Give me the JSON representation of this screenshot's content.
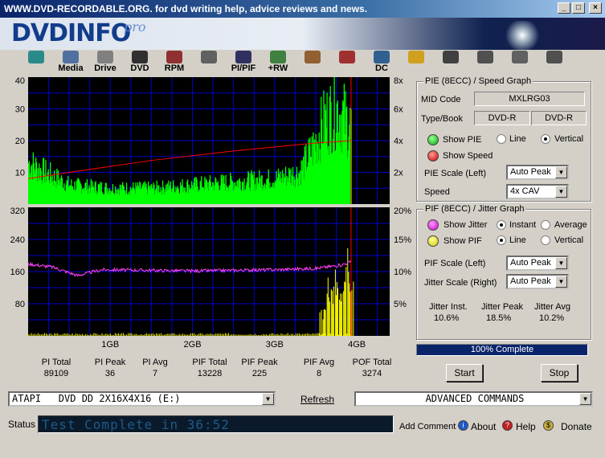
{
  "window": {
    "title": "WWW.DVD-RECORDABLE.ORG.  for dvd writing help, advice reviews and news.",
    "minimize": "_",
    "maximize": "□",
    "close": "×"
  },
  "banner": {
    "logo": "DVDINFO",
    "logo_pro": "pro"
  },
  "toolbar": [
    {
      "label": "",
      "icon": "monitor-icon"
    },
    {
      "label": "Media",
      "icon": "media-icon"
    },
    {
      "label": "Drive",
      "icon": "drive-icon"
    },
    {
      "label": "DVD",
      "icon": "dvd-icon"
    },
    {
      "label": "RPM",
      "icon": "rpm-icon"
    },
    {
      "label": "",
      "icon": "magnifier-icon"
    },
    {
      "label": "PI/PIF",
      "icon": "pipif-icon"
    },
    {
      "label": "+RW",
      "icon": "rw-icon"
    },
    {
      "label": "",
      "icon": "disc-edit-icon"
    },
    {
      "label": "",
      "icon": "write-icon"
    },
    {
      "label": "DC",
      "icon": "dc-icon"
    },
    {
      "label": "",
      "icon": "clipboard-icon"
    },
    {
      "label": "",
      "icon": "camera-icon"
    },
    {
      "label": "",
      "icon": "notes-icon"
    },
    {
      "label": "",
      "icon": "pause-icon"
    },
    {
      "label": "",
      "icon": "stop-icon"
    }
  ],
  "pie_graph": {
    "group_title": "PIE (8ECC) / Speed Graph",
    "mid_code_label": "MID Code",
    "mid_code": "MXLRG03",
    "type_book_label": "Type/Book",
    "type": "DVD-R",
    "book": "DVD-R",
    "show_pie": "Show PIE",
    "line": "Line",
    "vertical": "Vertical",
    "show_speed": "Show Speed",
    "scale_label": "PIE Scale (Left)",
    "scale_value": "Auto Peak",
    "speed_label": "Speed",
    "speed_value": "4x CAV"
  },
  "pif_graph": {
    "group_title": "PIF (8ECC) / Jitter Graph",
    "show_jitter": "Show Jitter",
    "instant": "Instant",
    "average": "Average",
    "show_pif": "Show PIF",
    "line": "Line",
    "vertical": "Vertical",
    "pif_scale_label": "PIF Scale (Left)",
    "pif_scale_value": "Auto Peak",
    "jitter_scale_label": "Jitter Scale (Right)",
    "jitter_scale_value": "Auto Peak",
    "jitter_inst_label": "Jitter Inst.",
    "jitter_inst": "10.6%",
    "jitter_peak_label": "Jitter Peak",
    "jitter_peak": "18.5%",
    "jitter_avg_label": "Jitter Avg",
    "jitter_avg": "10.2%"
  },
  "progress": {
    "text": "100% Complete",
    "value": 1.0
  },
  "buttons": {
    "start": "Start",
    "stop": "Stop",
    "refresh": "Refresh",
    "add_comment": "Add Comment",
    "about": "About",
    "help": "Help",
    "donate": "Donate"
  },
  "drive_select": "ATAPI   DVD DD 2X16X4X16 (E:)",
  "advanced_select": "ADVANCED COMMANDS",
  "status_label": "Status",
  "status_text": "Test Complete in 36:52",
  "stats": [
    {
      "label": "PI Total",
      "value": "89109"
    },
    {
      "label": "PI Peak",
      "value": "36"
    },
    {
      "label": "PI Avg",
      "value": "7"
    },
    {
      "label": "PIF Total",
      "value": "13228"
    },
    {
      "label": "PIF Peak",
      "value": "225"
    },
    {
      "label": "PIF Avg",
      "value": "8"
    },
    {
      "label": "POF Total",
      "value": "3274"
    }
  ],
  "chart_data": [
    {
      "type": "bar",
      "title": "",
      "ylim": [
        0,
        40
      ],
      "y_ticks": [
        "40",
        "30",
        "20",
        "10"
      ],
      "y2_ticks": [
        "8x",
        "6x",
        "4x",
        "2x"
      ],
      "y2lim": [
        0,
        8
      ],
      "xlim": [
        0,
        4.4
      ],
      "x_end": 3.93,
      "colors": {
        "pie": "#00ff00",
        "speed": "#ff0000",
        "bg": "#000000",
        "grid": "#0000cc"
      },
      "pie_profile": [
        {
          "x": 0.0,
          "y": 13
        },
        {
          "x": 0.2,
          "y": 10
        },
        {
          "x": 0.5,
          "y": 6
        },
        {
          "x": 1.0,
          "y": 5
        },
        {
          "x": 1.5,
          "y": 5
        },
        {
          "x": 2.0,
          "y": 6
        },
        {
          "x": 2.5,
          "y": 7
        },
        {
          "x": 3.0,
          "y": 8
        },
        {
          "x": 3.3,
          "y": 10
        },
        {
          "x": 3.45,
          "y": 17
        },
        {
          "x": 3.6,
          "y": 26
        },
        {
          "x": 3.75,
          "y": 30
        },
        {
          "x": 3.93,
          "y": 24
        }
      ],
      "speed_line": [
        {
          "x": 0.0,
          "y": 1.6
        },
        {
          "x": 0.5,
          "y": 2.0
        },
        {
          "x": 1.5,
          "y": 2.75
        },
        {
          "x": 2.5,
          "y": 3.35
        },
        {
          "x": 3.5,
          "y": 3.85
        },
        {
          "x": 3.93,
          "y": 4.0
        }
      ]
    },
    {
      "type": "line",
      "title": "",
      "ylim": [
        0,
        320
      ],
      "y_ticks": [
        "320",
        "240",
        "160",
        "80"
      ],
      "y2_ticks": [
        "20%",
        "15%",
        "10%",
        "5%"
      ],
      "y2lim": [
        0,
        20
      ],
      "xlim": [
        0,
        4.4
      ],
      "x_ticks": [
        "1GB",
        "2GB",
        "3GB",
        "4GB"
      ],
      "colors": {
        "pif": "#ffff00",
        "jitter": "#ff40ff",
        "bg": "#000000",
        "grid": "#0000cc"
      },
      "jitter_line": [
        {
          "x": 0.0,
          "y": 11.2
        },
        {
          "x": 0.3,
          "y": 10.7
        },
        {
          "x": 0.6,
          "y": 9.4
        },
        {
          "x": 0.9,
          "y": 10.3
        },
        {
          "x": 1.5,
          "y": 10.2
        },
        {
          "x": 2.0,
          "y": 10.1
        },
        {
          "x": 2.5,
          "y": 10.2
        },
        {
          "x": 3.0,
          "y": 10.3
        },
        {
          "x": 3.5,
          "y": 10.5
        },
        {
          "x": 3.8,
          "y": 11.0
        },
        {
          "x": 3.93,
          "y": 11.5
        }
      ],
      "pif_bursts": [
        {
          "x": 3.55,
          "y": 80
        },
        {
          "x": 3.6,
          "y": 120
        },
        {
          "x": 3.65,
          "y": 150
        },
        {
          "x": 3.7,
          "y": 180
        },
        {
          "x": 3.75,
          "y": 140
        },
        {
          "x": 3.8,
          "y": 200
        },
        {
          "x": 3.85,
          "y": 225
        },
        {
          "x": 3.9,
          "y": 170
        }
      ]
    }
  ]
}
